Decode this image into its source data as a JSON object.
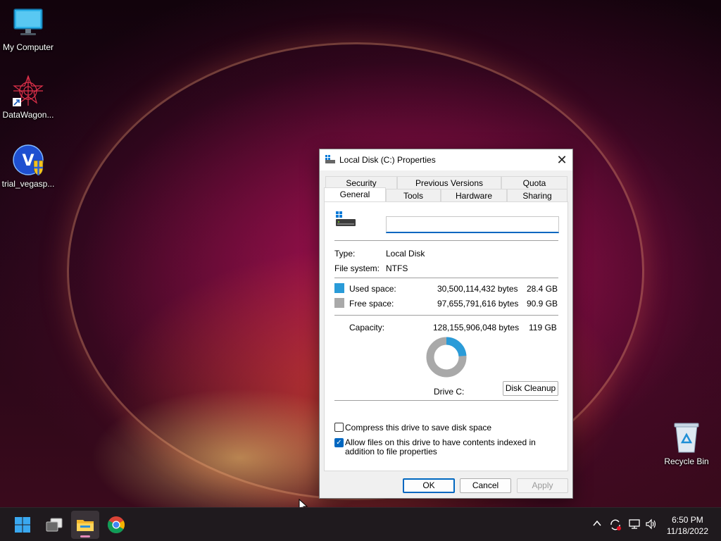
{
  "desktop": {
    "icons": [
      {
        "label": "My Computer"
      },
      {
        "label": "DataWagon..."
      },
      {
        "label": "trial_vegasp..."
      },
      {
        "label": "Recycle Bin"
      }
    ]
  },
  "dialog": {
    "title": "Local Disk (C:) Properties",
    "close_glyph": "✕",
    "tabs_row1": [
      "Security",
      "Previous Versions",
      "Quota"
    ],
    "tabs_row2": [
      "General",
      "Tools",
      "Hardware",
      "Sharing"
    ],
    "active_tab": "General",
    "drive_name_value": "",
    "type_label": "Type:",
    "type_value": "Local Disk",
    "fs_label": "File system:",
    "fs_value": "NTFS",
    "used_label": "Used space:",
    "used_bytes": "30,500,114,432 bytes",
    "used_gb": "28.4 GB",
    "free_label": "Free space:",
    "free_bytes": "97,655,791,616 bytes",
    "free_gb": "90.9 GB",
    "capacity_label": "Capacity:",
    "capacity_bytes": "128,155,906,048 bytes",
    "capacity_gb": "119 GB",
    "used_fraction": 0.238,
    "used_color": "#2a9bd8",
    "free_color": "#a9a9a9",
    "drive_label": "Drive C:",
    "cleanup_button": "Disk Cleanup",
    "compress_label": "Compress this drive to save disk space",
    "compress_checked": false,
    "index_label": "Allow files on this drive to have contents indexed in addition to file properties",
    "index_checked": true,
    "ok_button": "OK",
    "cancel_button": "Cancel",
    "apply_button": "Apply"
  },
  "taskbar": {
    "time": "6:50 PM",
    "date": "11/18/2022",
    "apps": [
      "start-icon",
      "task-view-icon",
      "file-explorer-icon",
      "chrome-icon"
    ],
    "tray_icons": [
      "chevron-up-icon",
      "sync-icon",
      "network-icon",
      "volume-icon"
    ]
  }
}
